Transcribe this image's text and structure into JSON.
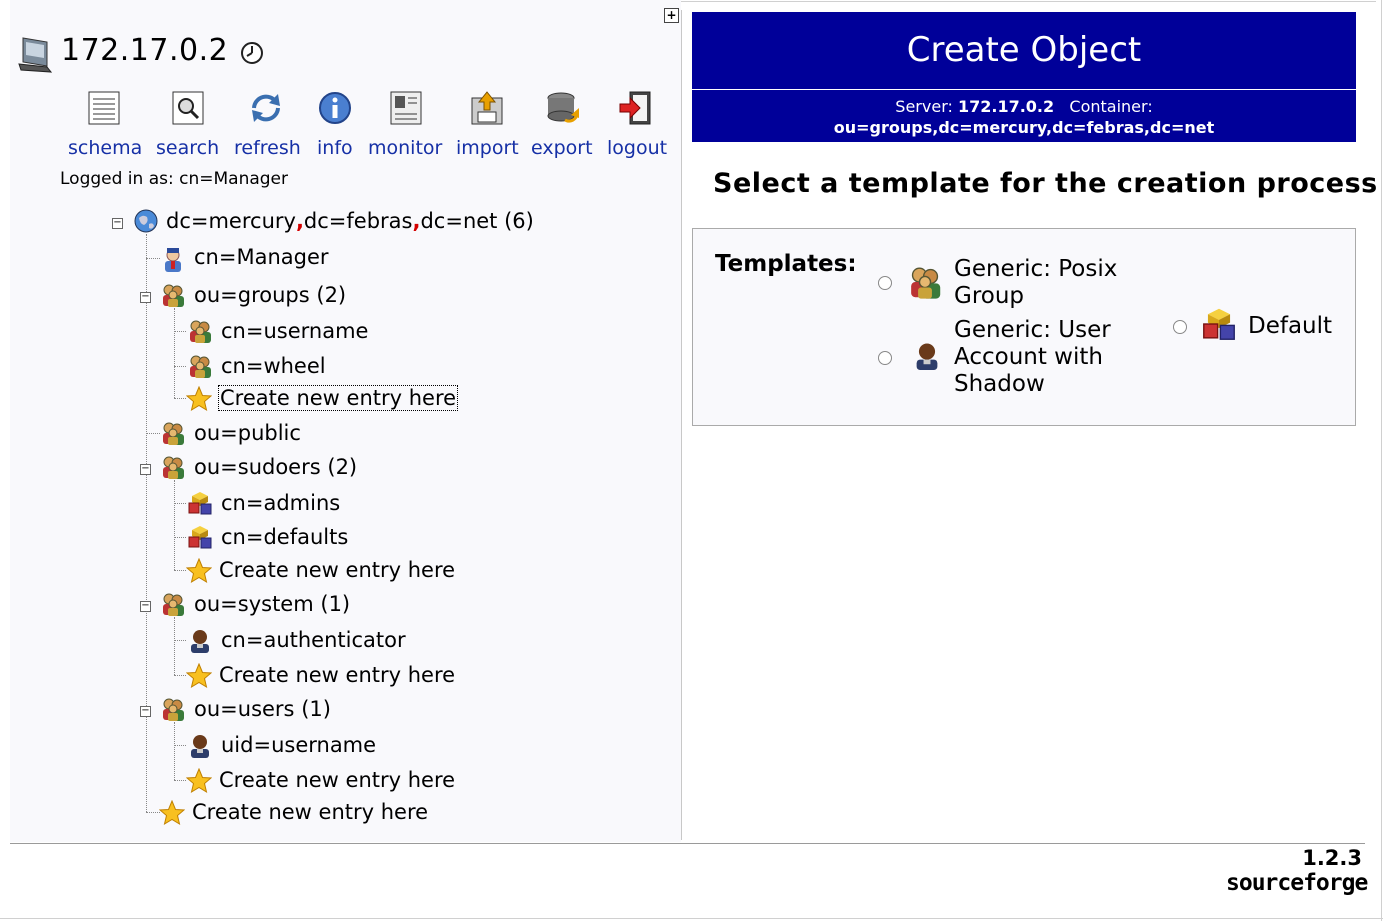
{
  "server": {
    "name": "172.17.0.2"
  },
  "toolbar": {
    "schema": "schema",
    "search": "search",
    "refresh": "refresh",
    "info": "info",
    "monitor": "monitor",
    "import": "import",
    "export": "export",
    "logout": "logout"
  },
  "logged_in": "Logged in as: cn=Manager",
  "tree": {
    "root": {
      "parts": [
        "dc=mercury",
        "dc=febras",
        "dc=net"
      ],
      "count": "(6)"
    },
    "manager": "cn=Manager",
    "groups": {
      "label": "ou=groups",
      "count": "(2)",
      "children": [
        "cn=username",
        "cn=wheel"
      ],
      "create": "Create new entry here"
    },
    "public": "ou=public",
    "sudoers": {
      "label": "ou=sudoers",
      "count": "(2)",
      "children": [
        "cn=admins",
        "cn=defaults"
      ],
      "create": "Create new entry here"
    },
    "system": {
      "label": "ou=system",
      "count": "(1)",
      "children": [
        "cn=authenticator"
      ],
      "create": "Create new entry here"
    },
    "users": {
      "label": "ou=users",
      "count": "(1)",
      "children": [
        "uid=username"
      ],
      "create": "Create new entry here"
    },
    "root_create": "Create new entry here"
  },
  "panel": {
    "title": "Create Object",
    "server_label": "Server:",
    "server_value": "172.17.0.2",
    "container_label": "Container:",
    "container_value": "ou=groups,dc=mercury,dc=febras,dc=net",
    "heading": "Select a template for the creation process",
    "templates_label": "Templates:",
    "templates": [
      {
        "name": "Generic: Posix Group",
        "icon": "group-icon"
      },
      {
        "name": "Generic: User Account with Shadow",
        "icon": "user-icon"
      },
      {
        "name": "Default",
        "icon": "blocks-icon"
      }
    ]
  },
  "footer": {
    "version": "1.2.3",
    "logo": "sourceforge"
  }
}
